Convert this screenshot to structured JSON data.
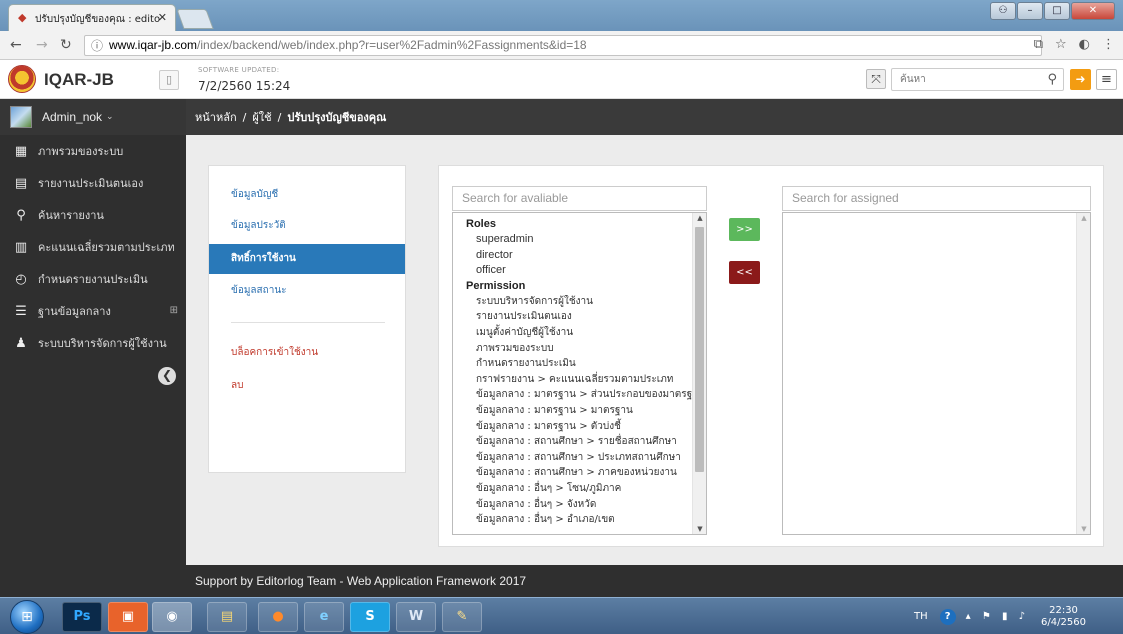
{
  "browser": {
    "tab_title": "ปรับปรุงบัญชีของคุณ : edito",
    "url_host": "www.iqar-jb.com",
    "url_path": "/index/backend/web/index.php?r=user%2Fadmin%2Fassignments&id=18"
  },
  "header": {
    "brand": "IQAR-JB",
    "updated_label": "SOFTWARE UPDATED:",
    "updated_date": "7/2/2560 15:24",
    "search_placeholder": "ค้นหา"
  },
  "sidebar": {
    "username": "Admin_nok",
    "items": [
      {
        "label": "ภาพรวมของระบบ",
        "icon": "dashboard-icon"
      },
      {
        "label": "รายงานประเมินตนเอง",
        "icon": "file-icon"
      },
      {
        "label": "ค้นหารายงาน",
        "icon": "search-icon"
      },
      {
        "label": "คะแนนเฉลี่ยรวมตามประเภท",
        "icon": "bar-chart-icon"
      },
      {
        "label": "กำหนดรายงานประเมิน",
        "icon": "clock-icon"
      },
      {
        "label": "ฐานข้อมูลกลาง",
        "icon": "database-icon"
      },
      {
        "label": "ระบบบริหารจัดการผู้ใช้งาน",
        "icon": "user-icon"
      }
    ]
  },
  "breadcrumb": {
    "home": "หน้าหลัก",
    "users": "ผู้ใช้",
    "current": "ปรับปรุงบัญชีของคุณ"
  },
  "account_menu": {
    "items": [
      "ข้อมูลบัญชี",
      "ข้อมูลประวัติ",
      "สิทธิ์การใช้งาน",
      "ข้อมูลสถานะ"
    ],
    "active_index": 2,
    "actions": [
      "บล็อคการเข้าใช้งาน",
      "ลบ"
    ]
  },
  "assignments": {
    "available_placeholder": "Search for avaliable",
    "assigned_placeholder": "Search for assigned",
    "add_label": ">>",
    "remove_label": "<<",
    "roles_heading": "Roles",
    "roles": [
      "superadmin",
      "director",
      "officer"
    ],
    "permission_heading": "Permission",
    "permissions": [
      "ระบบบริหารจัดการผู้ใช้งาน",
      "รายงานประเมินตนเอง",
      "เมนูตั้งค่าบัญชีผู้ใช้งาน",
      "ภาพรวมของระบบ",
      "กำหนดรายงานประเมิน",
      "กราฟรายงาน > คะแนนเฉลี่ยรวมตามประเภท",
      "ข้อมูลกลาง : มาตรฐาน > ส่วนประกอบของมาตรฐาน",
      "ข้อมูลกลาง : มาตรฐาน > มาตรฐาน",
      "ข้อมูลกลาง : มาตรฐาน > ตัวบ่งชี้",
      "ข้อมูลกลาง : สถานศึกษา > รายชื่อสถานศึกษา",
      "ข้อมูลกลาง : สถานศึกษา > ประเภทสถานศึกษา",
      "ข้อมูลกลาง : สถานศึกษา > ภาคของหน่วยงาน",
      "ข้อมูลกลาง : อื่นๆ > โซน/ภูมิภาค",
      "ข้อมูลกลาง : อื่นๆ > จังหวัด",
      "ข้อมูลกลาง : อื่นๆ > อำเภอ/เขต"
    ]
  },
  "footer": {
    "text": "Support by Editorlog Team - Web Application Framework 2017"
  },
  "taskbar": {
    "lang": "TH",
    "time": "22:30",
    "date": "6/4/2560"
  }
}
